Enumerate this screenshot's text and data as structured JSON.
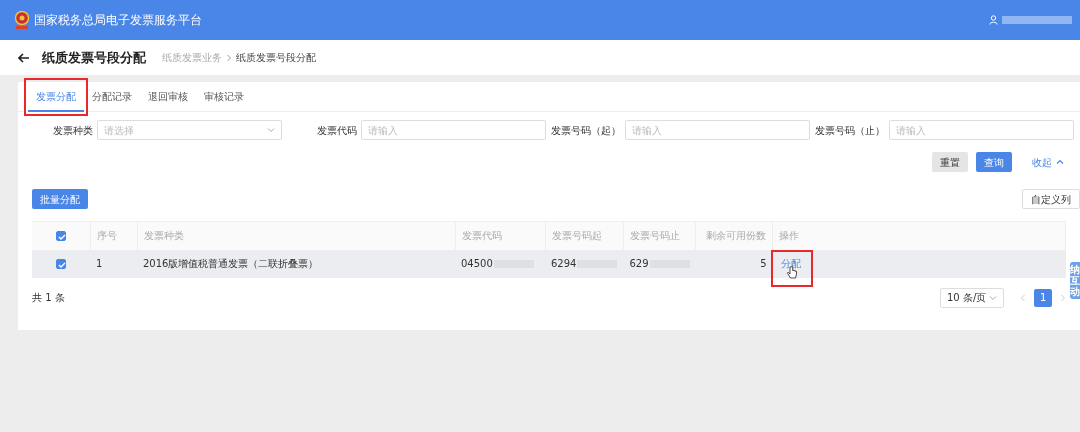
{
  "app": {
    "title": "国家税务总局电子发票服务平台"
  },
  "page": {
    "title": "纸质发票号段分配",
    "breadcrumb": [
      "纸质发票业务",
      "纸质发票号段分配"
    ]
  },
  "tabs": [
    {
      "label": "发票分配",
      "selected": true,
      "highlighted": true
    },
    {
      "label": "分配记录",
      "selected": false,
      "highlighted": false
    },
    {
      "label": "退回审核",
      "selected": false,
      "highlighted": false
    },
    {
      "label": "审核记录",
      "selected": false,
      "highlighted": false
    }
  ],
  "filters": [
    {
      "kind": "select",
      "label": "发票种类",
      "placeholder": "请选择"
    },
    {
      "kind": "input",
      "label": "发票代码",
      "placeholder": "请输入"
    },
    {
      "kind": "input",
      "label": "发票号码（起）",
      "placeholder": "请输入"
    },
    {
      "kind": "input",
      "label": "发票号码（止）",
      "placeholder": "请输入"
    }
  ],
  "actions": {
    "reset": "重置",
    "search": "查询",
    "collapse": "收起",
    "batch": "批量分配",
    "columns": "自定义列"
  },
  "table": {
    "all_checked": true,
    "columns": [
      "序号",
      "发票种类",
      "发票代码",
      "发票号码起",
      "发票号码止",
      "剩余可用份数",
      "操作"
    ],
    "rows": [
      {
        "checked": true,
        "selected": true,
        "cells": [
          "1",
          "2016版增值税普通发票（二联折叠票）",
          "04500",
          "6294",
          "629",
          "5"
        ],
        "action": "分配",
        "action_highlighted": true
      }
    ]
  },
  "footer": {
    "total": "共 1 条",
    "page_size": "10 条/页",
    "pages": [
      {
        "label": "1",
        "selected": true
      }
    ]
  },
  "side_tab": "纳互动"
}
